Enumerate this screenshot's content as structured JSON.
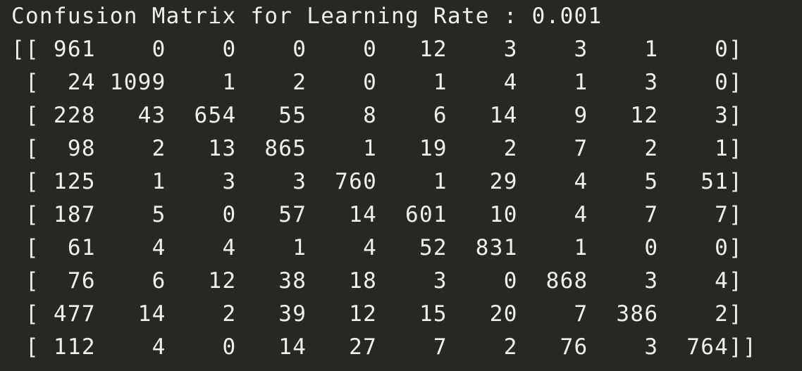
{
  "output": {
    "title": "Confusion Matrix for Learning Rate : 0.001",
    "rows": [
      "[[ 961    0    0    0    0   12    3    3    1    0]",
      " [  24 1099    1    2    0    1    4    1    3    0]",
      " [ 228   43  654   55    8    6   14    9   12    3]",
      " [  98    2   13  865    1   19    2    7    2    1]",
      " [ 125    1    3    3  760    1   29    4    5   51]",
      " [ 187    5    0   57   14  601   10    4    7    7]",
      " [  61    4    4    1    4   52  831    1    0    0]",
      " [  76    6   12   38   18    3    0  868    3    4]",
      " [ 477   14    2   39   12   15   20    7  386    2]",
      " [ 112    4    0   14   27    7    2   76    3  764]]"
    ]
  }
}
